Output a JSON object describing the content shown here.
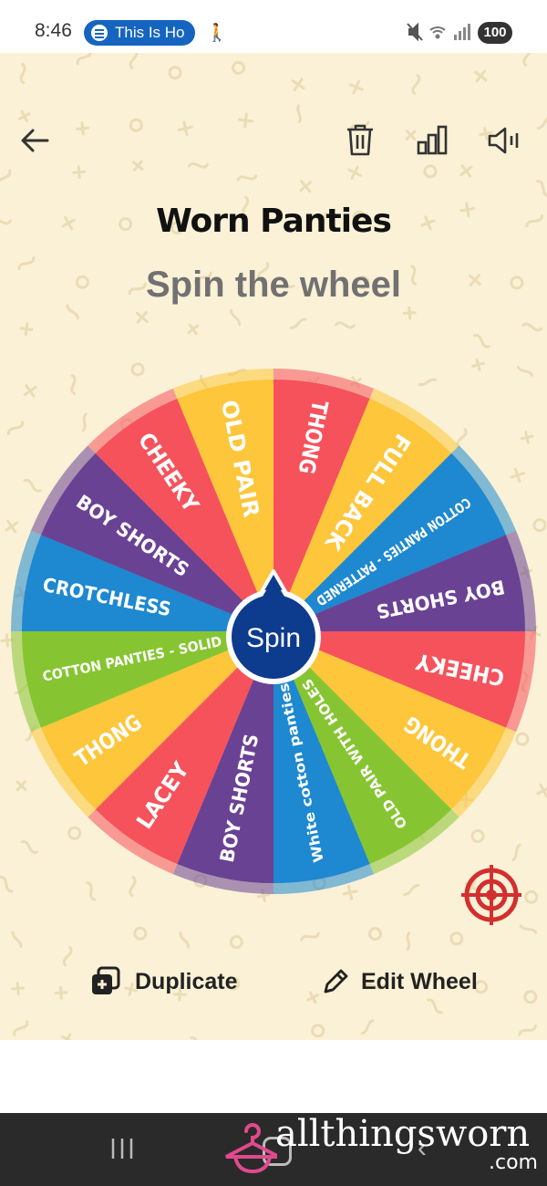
{
  "status": {
    "time": "8:46",
    "media_pill": "This Is Ho",
    "battery": "100"
  },
  "toolbar": {
    "back_icon": "arrow-left-icon",
    "delete_icon": "trash-icon",
    "stats_icon": "bar-chart-icon",
    "sound_icon": "speaker-icon"
  },
  "title": "Worn Panties",
  "subtitle": "Spin the wheel",
  "wheel": {
    "spin_label": "Spin",
    "segments": [
      {
        "label": "THONG",
        "color": "#f6525c"
      },
      {
        "label": "FULL BACK",
        "color": "#fdc63b"
      },
      {
        "label": "COTTON PANTIES - PATTERNED",
        "color": "#1e88d0"
      },
      {
        "label": "BOY SHORTS",
        "color": "#6a4294"
      },
      {
        "label": "CHEEKY",
        "color": "#f6525c"
      },
      {
        "label": "THONG",
        "color": "#fdc63b"
      },
      {
        "label": "OLD PAIR WITH HOLES",
        "color": "#86c531"
      },
      {
        "label": "White cotton panties",
        "color": "#1e88d0"
      },
      {
        "label": "BOY SHORTS",
        "color": "#6a4294"
      },
      {
        "label": "LACEY",
        "color": "#f6525c"
      },
      {
        "label": "THONG",
        "color": "#fdc63b"
      },
      {
        "label": "COTTON PANTIES - SOLID",
        "color": "#86c531"
      },
      {
        "label": "CROTCHLESS",
        "color": "#1e88d0"
      },
      {
        "label": "BOY SHORTS",
        "color": "#6a4294"
      },
      {
        "label": "CHEEKY",
        "color": "#f6525c"
      },
      {
        "label": "OLD PAIR",
        "color": "#fdc63b"
      }
    ],
    "hub_color": "#0d3b8e"
  },
  "actions": {
    "duplicate": "Duplicate",
    "edit": "Edit Wheel"
  },
  "watermark": {
    "brand": "allthingsworn",
    "tld": ".com"
  },
  "colors": {
    "background": "#fbf1d6",
    "accent_target": "#d32f2f"
  }
}
